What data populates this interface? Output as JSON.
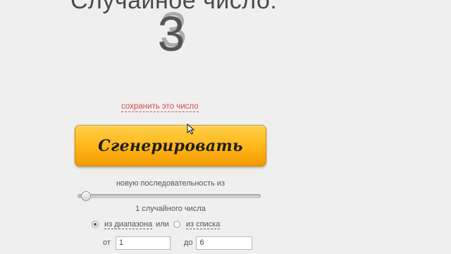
{
  "generator": {
    "title": "Случайное число:",
    "result_number": "3",
    "save_link": "сохранить это число",
    "generate_button": "Сгенерировать"
  },
  "sequence": {
    "label": "новую последовательность из",
    "count_text": "1 случайного числа",
    "slider_fraction": 0.02
  },
  "mode": {
    "from_range_label": "из диапазона",
    "or_label": "или",
    "from_list_label": "из списка",
    "selected": "range"
  },
  "range": {
    "from_label": "от",
    "from_value": "1",
    "to_label": "до",
    "to_value": "6"
  }
}
